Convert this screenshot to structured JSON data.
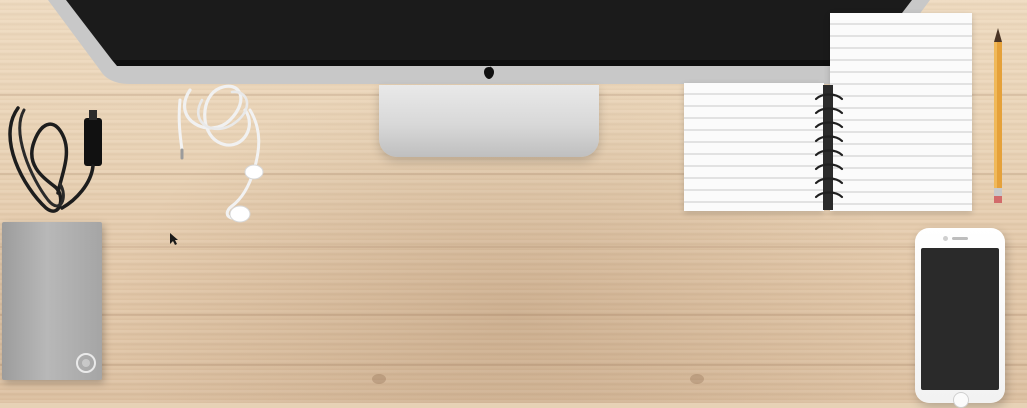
{
  "scene": {
    "colors": {
      "desk_light": "#eed9bd",
      "desk_dark": "#dcbf9f",
      "imac_bezel": "#c9c9c9",
      "screen_black": "#1b1b1b",
      "blue_frame": "#1f3f9a",
      "pencil_orange": "#e5a13a",
      "drive_silver": "#b8b8b8"
    },
    "icons": {
      "apple_logo": "apple-logo-icon",
      "mouse_cursor": "mouse-cursor-icon",
      "drive_logo": "drive-logo-icon"
    }
  }
}
